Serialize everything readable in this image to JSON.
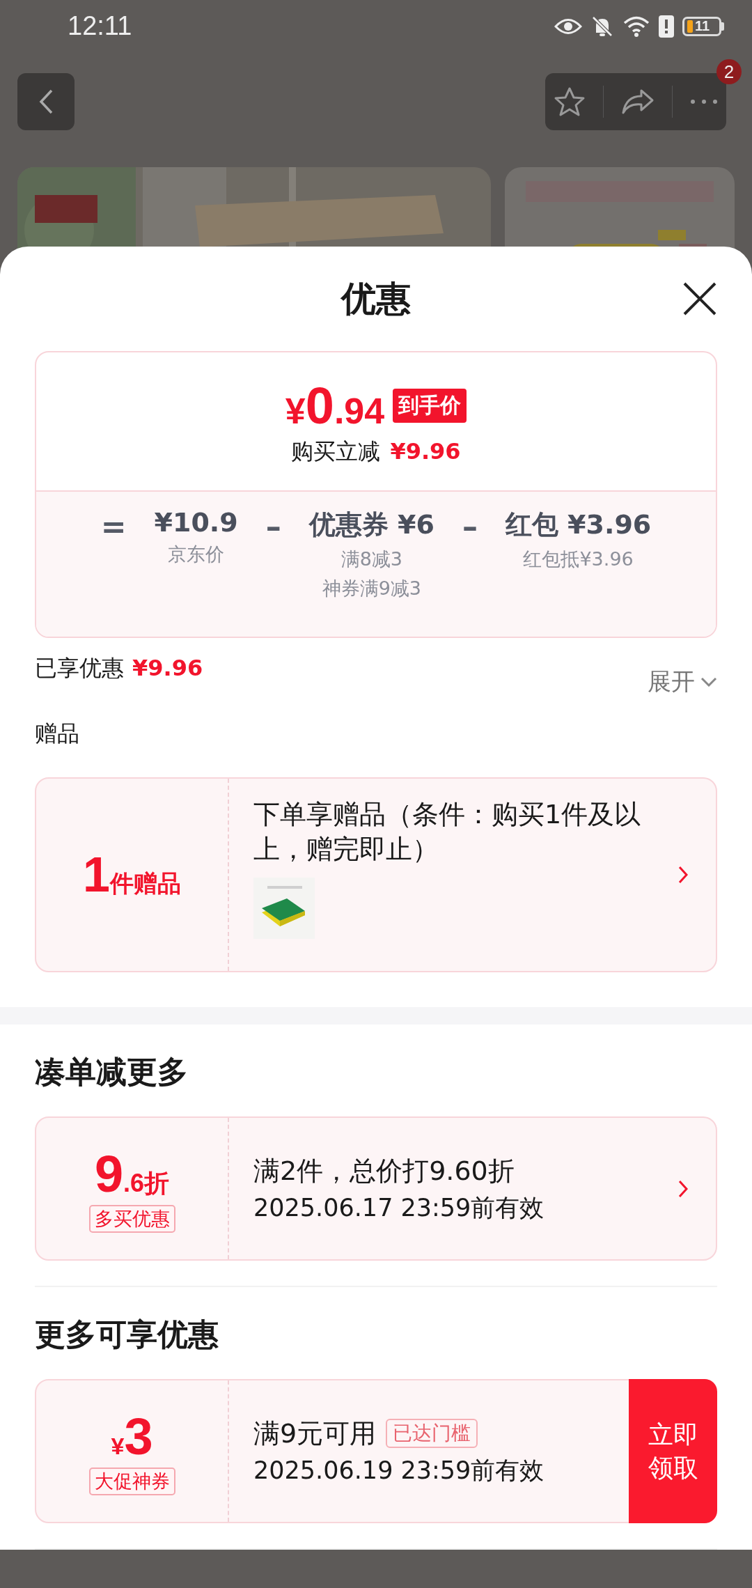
{
  "status_bar": {
    "time": "12:11",
    "battery": "11"
  },
  "top_bar": {
    "badge": "2"
  },
  "sheet": {
    "title": "优惠",
    "price_card": {
      "price": {
        "currency": "¥",
        "integer": "0",
        "decimal": ".94"
      },
      "price_tag": "到手价",
      "saving_label": "购买立减",
      "saving_value": "¥9.96",
      "breakdown": [
        {
          "operator": "=",
          "amount": "¥10.9",
          "notes": [
            "京东价"
          ]
        },
        {
          "operator": "–",
          "amount": "优惠券 ¥6",
          "notes": [
            "满8减3",
            "神券满9减3"
          ]
        },
        {
          "operator": "–",
          "amount": "红包 ¥3.96",
          "notes": [
            "红包抵¥3.96"
          ]
        }
      ]
    },
    "enjoyed": {
      "label": "已享优惠",
      "value": "¥9.96",
      "toggle": "展开"
    },
    "gifts": {
      "heading": "赠品",
      "items": [
        {
          "count_number": "1",
          "count_unit": "件赠品",
          "description": "下单享赠品（条件：购买1件及以上，赠完即止）"
        }
      ]
    },
    "bundle": {
      "heading": "凑单减更多",
      "offers": [
        {
          "value_main": "9",
          "value_suffix": ".6折",
          "tag": "多买优惠",
          "title": "满2件，总价打9.60折",
          "validity": "2025.06.17 23:59前有效"
        }
      ]
    },
    "more": {
      "heading": "更多可享优惠",
      "coupons": [
        {
          "currency": "¥",
          "amount": "3",
          "tag": "大促神券",
          "title": "满9元可用",
          "badge": "已达门槛",
          "validity": "2025.06.19 23:59前有效",
          "action": "立即领取"
        }
      ]
    }
  }
}
